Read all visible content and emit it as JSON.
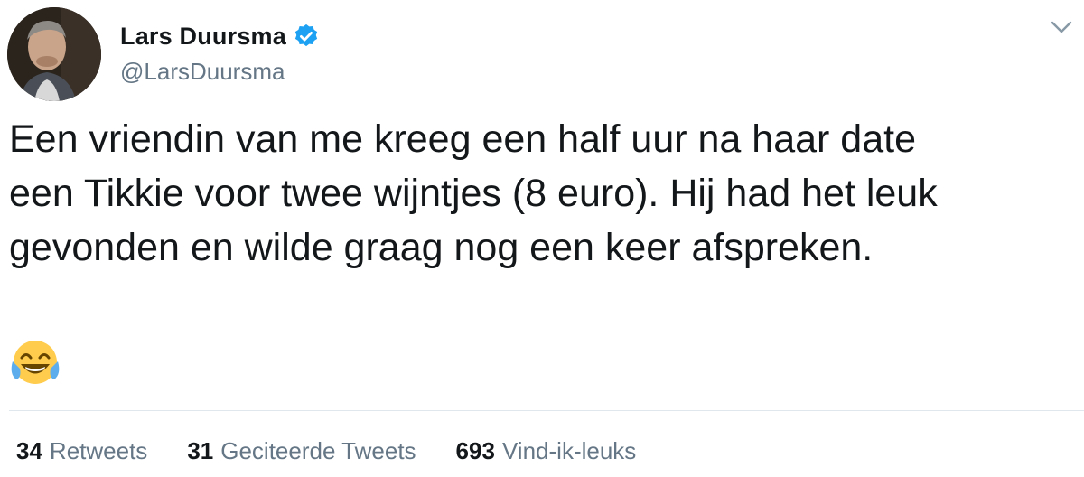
{
  "tweet": {
    "author": {
      "display_name": "Lars Duursma",
      "handle": "@LarsDuursma",
      "verified": true,
      "avatar_icon": "avatar-photo"
    },
    "text": "Een vriendin van me kreeg een half uur na haar date\neen Tikkie voor twee wijntjes (8 euro). Hij had het leuk\ngevonden en wilde graag nog een keer afspreken.",
    "emoji": "face-with-tears-of-joy",
    "menu_icon": "chevron-down-icon"
  },
  "stats": {
    "retweets": {
      "count": "34",
      "label": "Retweets"
    },
    "quotes": {
      "count": "31",
      "label": "Geciteerde Tweets"
    },
    "likes": {
      "count": "693",
      "label": "Vind-ik-leuks"
    }
  },
  "colors": {
    "text_primary": "#14171a",
    "text_secondary": "#657786",
    "verified_blue": "#1da1f2",
    "divider": "#e1e8ed"
  }
}
